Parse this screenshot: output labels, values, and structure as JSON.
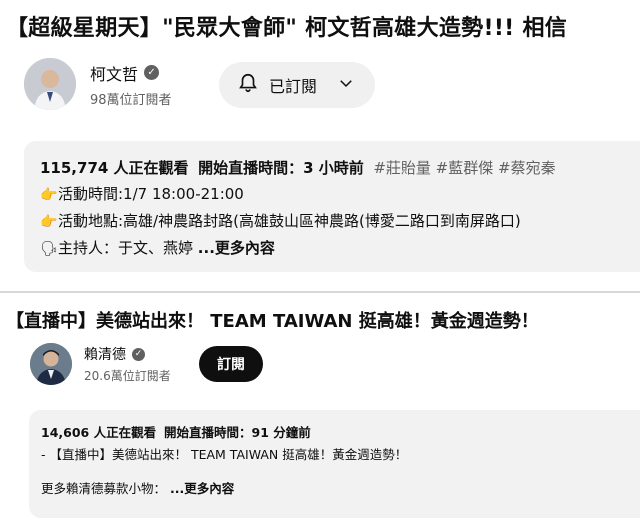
{
  "video1": {
    "title": "【超級星期天】\"民眾大會師\" 柯文哲高雄大造勢!!! 相信",
    "channel": "柯文哲",
    "subscribers": "98萬位訂閱者",
    "subscribe_label": "已訂閱",
    "bell_icon": "bell-icon",
    "dropdown_icon": "chevron-down-icon",
    "viewers": "115,774 人正在觀看",
    "start_time": "開始直播時間：3 小時前",
    "tags": [
      "#莊貽量",
      "#藍群傑",
      "#蔡宛秦"
    ],
    "line_time": "活動時間:1/7 18:00-21:00",
    "line_place": "活動地點:高雄/神農路封路(高雄鼓山區神農路(博愛二路口到南屏路口)",
    "line_host": "主持人：于文、燕婷",
    "more_label": "...更多內容"
  },
  "video2": {
    "title": "【直播中】美德站出來！ TEAM TAIWAN 挺高雄！黃金週造勢！",
    "channel": "賴清德",
    "subscribers": "20.6萬位訂閱者",
    "subscribe_label": "訂閱",
    "viewers": "14,606 人正在觀看",
    "start_time": "開始直播時間：91 分鐘前",
    "desc_line": "- 【直播中】美德站出來！ TEAM TAIWAN 挺高雄！黃金週造勢！",
    "donate_line": "更多賴清德募款小物：",
    "more_label": "...更多內容"
  }
}
